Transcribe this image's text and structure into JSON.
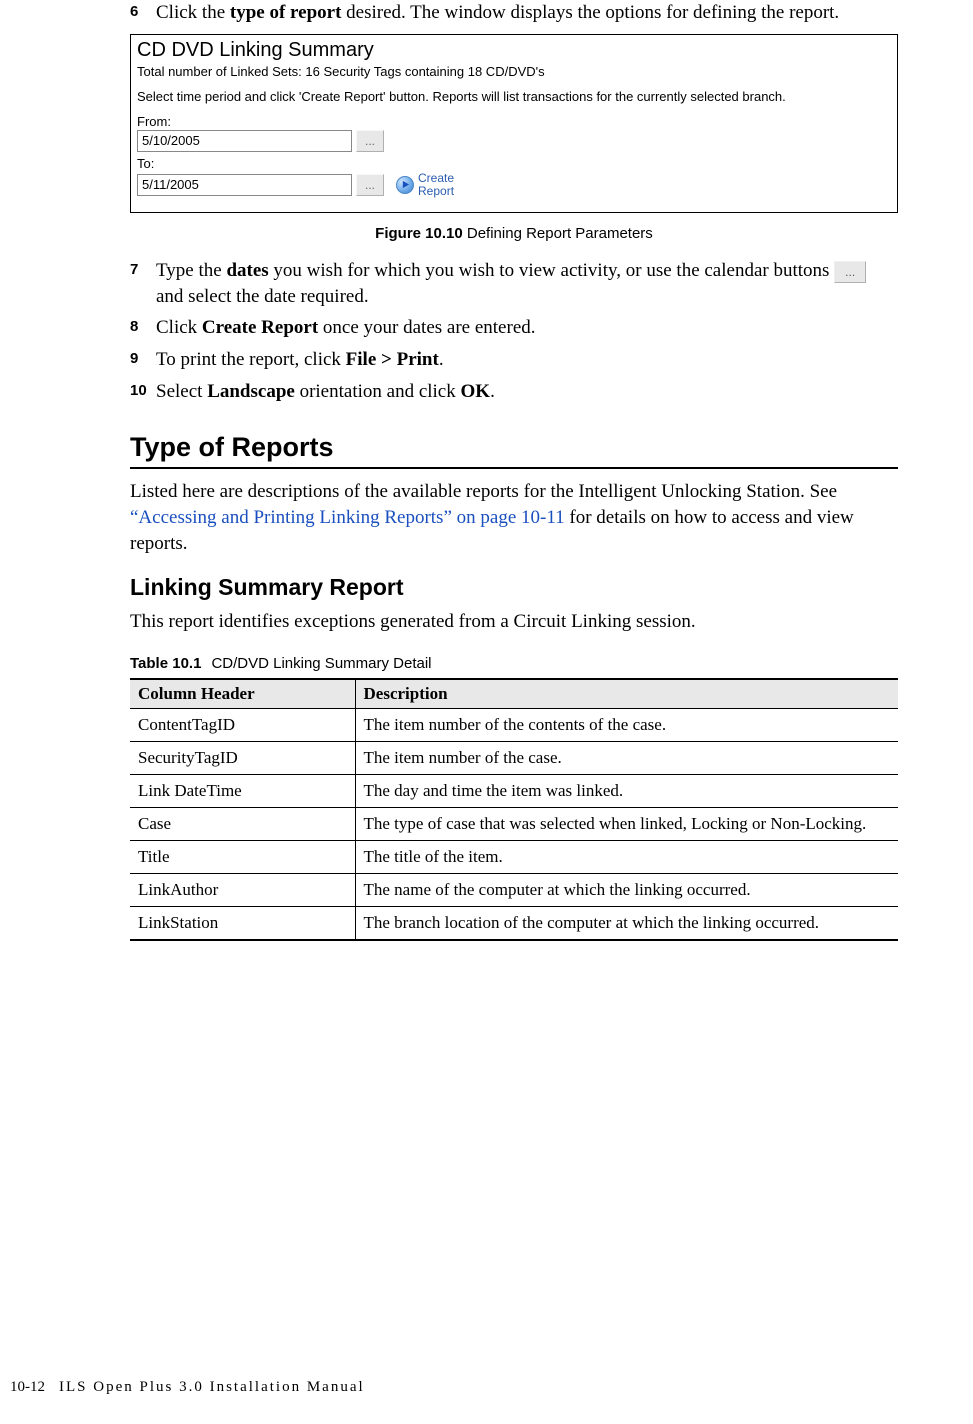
{
  "steps1": [
    {
      "num": "6",
      "html": "Click the <b>type of report</b> desired. The window displays the options for defining the report."
    }
  ],
  "figure": {
    "title": "CD DVD Linking Summary",
    "subtitle": "Total number of Linked Sets: 16 Security Tags containing 18 CD/DVD's",
    "instruction": "Select time period and click 'Create Report' button. Reports will list transactions for the currently selected branch.",
    "fromLabel": "From:",
    "toLabel": "To:",
    "fromValue": "5/10/2005",
    "toValue": "5/11/2005",
    "calBtn": "...",
    "createReportLine1": "Create",
    "createReportLine2": "Report"
  },
  "figureCaption": {
    "label": "Figure 10.10",
    "text": " Defining Report Parameters"
  },
  "steps2": [
    {
      "num": "7",
      "html": "Type the <b>dates</b> you wish for which you wish to view activity, or use the calendar buttons <span class=\"step-inline-btn\">...</span> and select the date required."
    },
    {
      "num": "8",
      "html": "Click <b>Create Report</b> once your dates are entered."
    },
    {
      "num": "9",
      "html": "To print the report, click <b>File > Print</b>."
    },
    {
      "num": "10",
      "html": "Select <b>Landscape</b> orientation and click <b>OK</b>."
    }
  ],
  "section": {
    "title": "Type of Reports",
    "paraBefore": "Listed here are descriptions of the available reports for the Intelligent Unlocking Station. See ",
    "paraLink": "“Accessing and Printing Linking Reports” on page 10-11",
    "paraAfter": " for details on how to access and view reports.",
    "subTitle": "Linking Summary Report",
    "subPara": "This report identifies exceptions generated from a Circuit Linking session."
  },
  "tableCaption": {
    "label": "Table 10.1",
    "text": "CD/DVD Linking Summary Detail"
  },
  "table": {
    "headers": [
      "Column Header",
      "Description"
    ],
    "rows": [
      [
        "ContentTagID",
        "The item number of the contents of the case."
      ],
      [
        "SecurityTagID",
        "The item number of the case."
      ],
      [
        "Link DateTime",
        "The day and time the item was linked."
      ],
      [
        "Case",
        "The type of case that was selected when linked, Locking or Non-Locking."
      ],
      [
        "Title",
        "The title of the item."
      ],
      [
        "LinkAuthor",
        "The name of the computer at which the linking occurred."
      ],
      [
        "LinkStation",
        "The branch location of the computer at which the linking occurred."
      ]
    ]
  },
  "footer": {
    "pageNum": "10-12",
    "title": "ILS Open Plus 3.0 Installation Manual"
  }
}
